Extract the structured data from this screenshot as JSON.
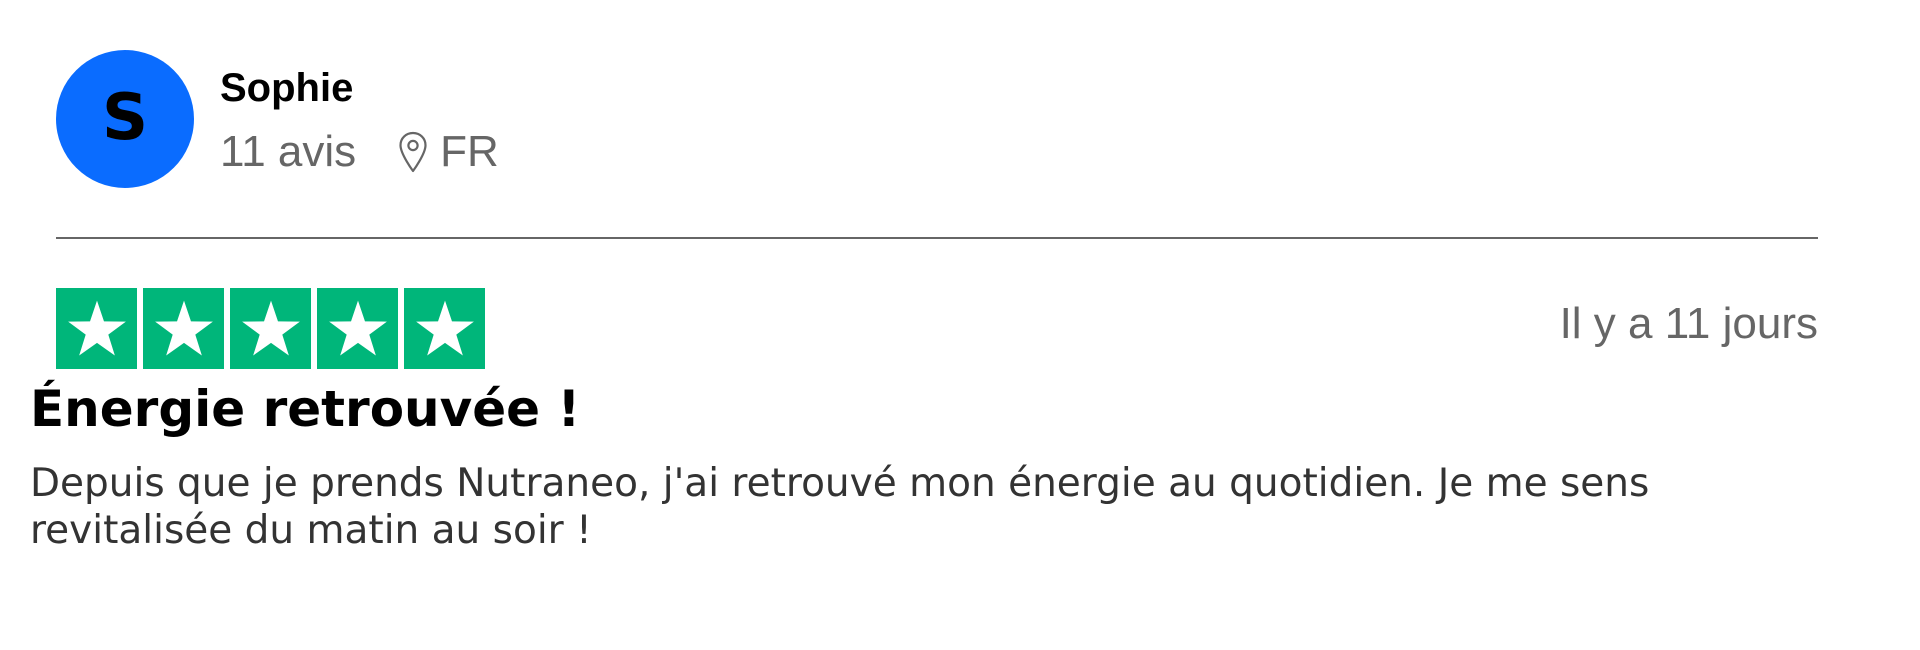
{
  "reviewer": {
    "initial": "S",
    "name": "Sophie",
    "review_count": "11 avis",
    "location": "FR",
    "location_icon": "map-pin-icon",
    "avatar_color": "#0a6cff"
  },
  "review": {
    "rating": 5,
    "rating_max": 5,
    "star_icon": "star-icon",
    "star_color": "#00b67a",
    "date": "Il y a 11 jours",
    "title": "Énergie retrouvée !",
    "body": "Depuis que je prends Nutraneo, j'ai retrouvé mon énergie au quotidien. Je me sens revitalisée du matin au soir !"
  }
}
